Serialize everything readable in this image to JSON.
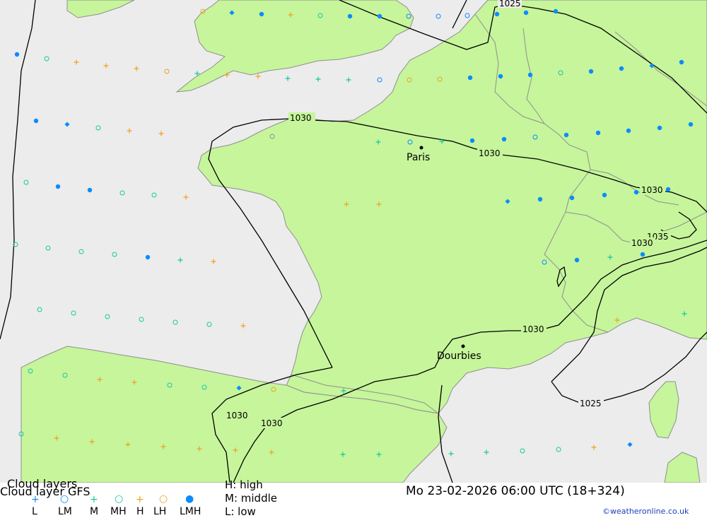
{
  "map": {
    "colors": {
      "sea": "#ececec",
      "land": "#c6f59b",
      "border": "#8f8f8f",
      "coast": "#8f8f8f",
      "isobar": "#000000",
      "cyan": "#14c8a0",
      "orange": "#f0a020",
      "blue": "#0a8cff"
    },
    "cities": [
      {
        "name": "Paris"
      },
      {
        "name": "Dourbies"
      }
    ],
    "isobar_labels": [
      "1025",
      "1030",
      "1030",
      "1030",
      "1035",
      "1030",
      "1030",
      "1025",
      "1030",
      "1030"
    ]
  },
  "footer": {
    "title_top": "Cloud layers",
    "title": "Cloud layer   GFS",
    "legend": [
      {
        "symbol": "+",
        "color": "#0a8cff",
        "label": "L"
      },
      {
        "symbol": "○",
        "color": "#0a8cff",
        "label": "LM"
      },
      {
        "symbol": "+",
        "color": "#14c8a0",
        "label": "M"
      },
      {
        "symbol": "○",
        "color": "#14c8a0",
        "label": "MH"
      },
      {
        "symbol": "+",
        "color": "#f0a020",
        "label": "H"
      },
      {
        "symbol": "○",
        "color": "#f0a020",
        "label": "LH"
      },
      {
        "symbol": "●",
        "color": "#0a8cff",
        "label": "LMH"
      }
    ],
    "key_high": "H: high",
    "key_middle": "M: middle",
    "key_low": "L: low",
    "datetime": "Mo 23-02-2026 06:00 UTC (18+324)",
    "credit": "©weatheronline.co.uk"
  }
}
